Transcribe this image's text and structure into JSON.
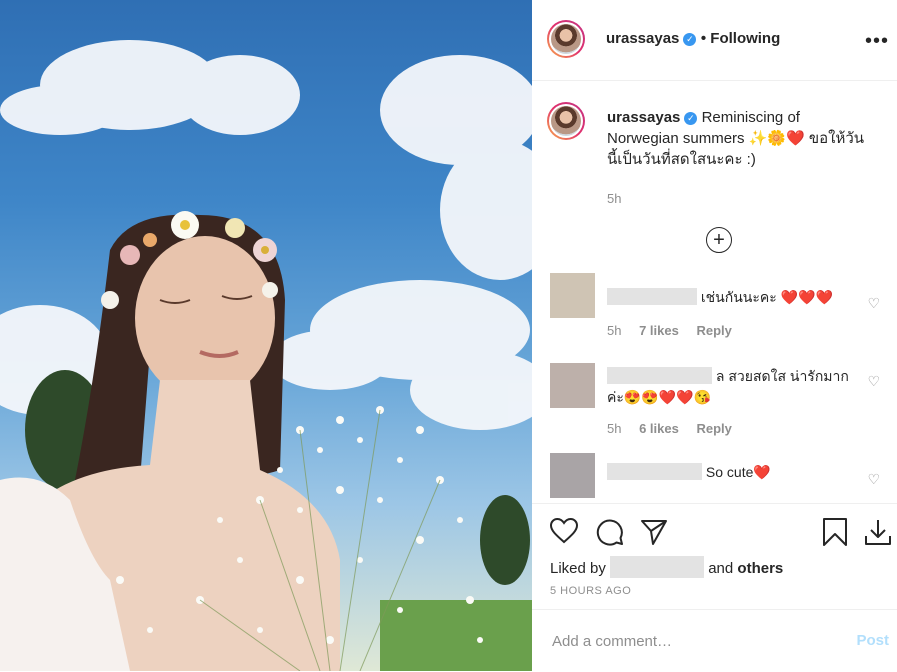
{
  "post": {
    "username": "urassayas",
    "follow_status": "• Following",
    "more": "•••"
  },
  "caption": {
    "username": "urassayas",
    "text": "Reminiscing of Norwegian summers ✨🌼❤️ ขอให้วันนี้เป็นวันที่สดใสนะคะ :)",
    "time": "5h"
  },
  "comments": [
    {
      "text": "เช่นกันนะคะ ❤️❤️❤️",
      "time": "5h",
      "likes": "7 likes",
      "reply": "Reply"
    },
    {
      "text": "ล สวยสดใส น่ารักมากค่ะ😍😍❤️❤️😘",
      "time": "5h",
      "likes": "6 likes",
      "reply": "Reply"
    },
    {
      "text": "So cute❤️"
    }
  ],
  "likes": {
    "prefix": "Liked by",
    "suffix": "and",
    "others": "others"
  },
  "post_time": "5 HOURS AGO",
  "add_comment": {
    "placeholder": "Add a comment…",
    "post_label": "Post"
  },
  "icons": {
    "like": "heart-icon",
    "comment": "comment-icon",
    "share": "paper-plane-icon",
    "save": "bookmark-icon",
    "download": "download-icon",
    "load_more": "plus-circle-icon"
  },
  "colors": {
    "verified": "#3897f0",
    "post_button": "#b2dffc",
    "heart": "#e0245e"
  }
}
